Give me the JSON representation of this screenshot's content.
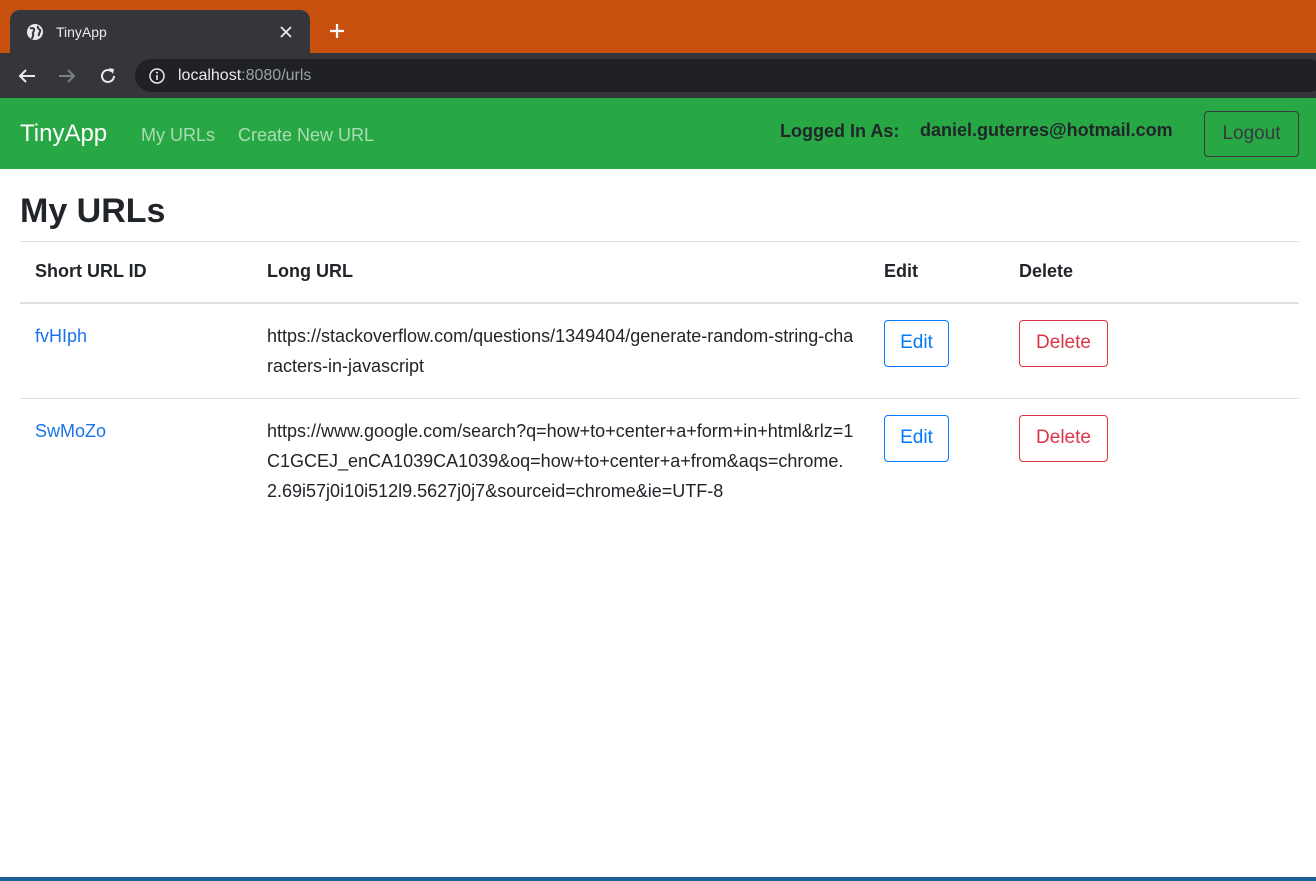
{
  "browser": {
    "tab_title": "TinyApp",
    "url_host": "localhost",
    "url_rest": ":8080/urls",
    "tabbar_color": "#c8510f"
  },
  "navbar": {
    "brand": "TinyApp",
    "links": [
      "My URLs",
      "Create New URL"
    ],
    "logged_in_label": "Logged In As:",
    "logged_in_email": "daniel.guterres@hotmail.com",
    "logout_label": "Logout",
    "color": "#28a745"
  },
  "main": {
    "title": "My URLs",
    "table": {
      "headers": [
        "Short URL ID",
        "Long URL",
        "Edit",
        "Delete"
      ],
      "rows": [
        {
          "short": "fvHIph",
          "long": "https://stackoverflow.com/questions/1349404/generate-random-string-characters-in-javascript",
          "edit": "Edit",
          "delete": "Delete"
        },
        {
          "short": "SwMoZo",
          "long": "https://www.google.com/search?q=how+to+center+a+form+in+html&rlz=1C1GCEJ_enCA1039CA1039&oq=how+to+center+a+from&aqs=chrome.2.69i57j0i10i512l9.5627j0j7&sourceid=chrome&ie=UTF-8",
          "edit": "Edit",
          "delete": "Delete"
        }
      ]
    }
  }
}
